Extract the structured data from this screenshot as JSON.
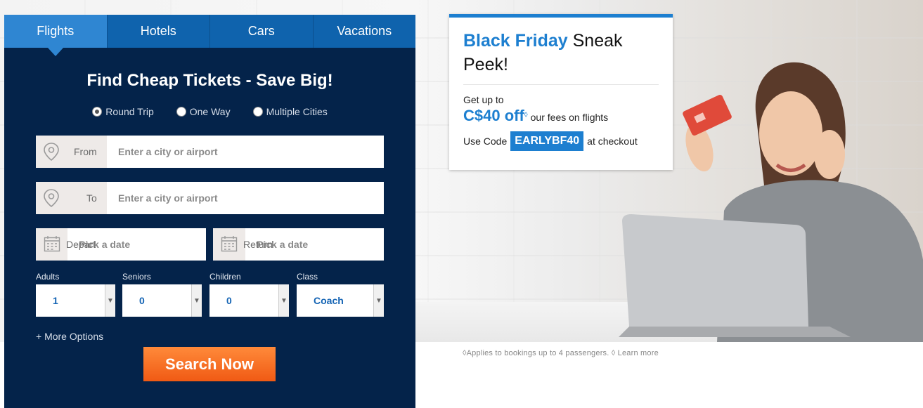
{
  "tabs": [
    {
      "label": "Flights"
    },
    {
      "label": "Hotels"
    },
    {
      "label": "Cars"
    },
    {
      "label": "Vacations"
    }
  ],
  "widget": {
    "title": "Find Cheap Tickets - Save Big!",
    "trip_types": [
      "Round Trip",
      "One Way",
      "Multiple Cities"
    ],
    "selected_trip_type": "Round Trip",
    "from": {
      "label": "From",
      "placeholder": "Enter a city or airport"
    },
    "to": {
      "label": "To",
      "placeholder": "Enter a city or airport"
    },
    "depart": {
      "label": "Depart",
      "placeholder": "Pick a date"
    },
    "return": {
      "label": "Return",
      "placeholder": "Pick a date"
    },
    "adults": {
      "label": "Adults",
      "value": "1"
    },
    "seniors": {
      "label": "Seniors",
      "value": "0"
    },
    "children": {
      "label": "Children",
      "value": "0"
    },
    "class": {
      "label": "Class",
      "value": "Coach"
    },
    "more_options": "+ More Options",
    "search_button": "Search Now"
  },
  "promo": {
    "headline_highlight": "Black Friday",
    "headline_rest": " Sneak Peek!",
    "up_to": "Get up to",
    "amount": "C$40 off",
    "amount_mark": "◊",
    "fees_text": " our fees on flights",
    "use_code": "Use Code",
    "code": "EARLYBF40",
    "at_checkout": "at checkout"
  },
  "footnote": "◊Applies to bookings up to 4 passengers. ◊ Learn more",
  "colors": {
    "widget_bg": "#04234a",
    "tab_bg": "#0f63ad",
    "active_tab_bg": "#2f86d2",
    "accent": "#1d7fd0",
    "search_button": "#f05a14"
  }
}
